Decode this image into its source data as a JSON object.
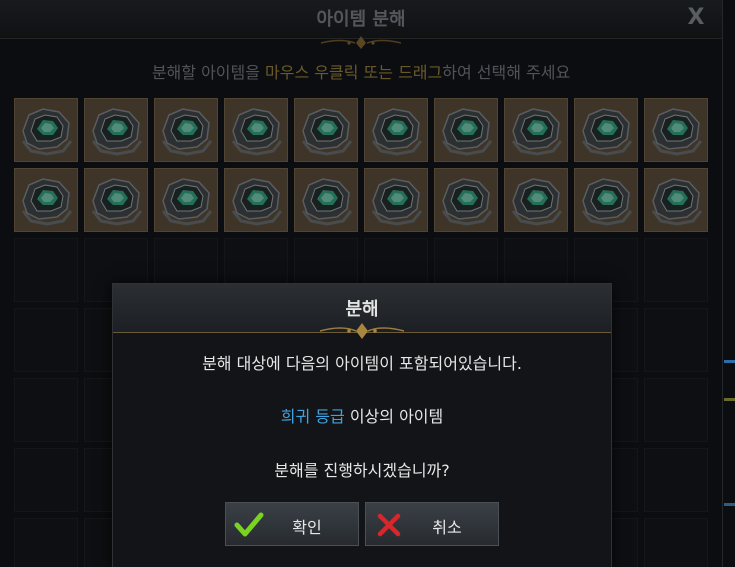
{
  "window": {
    "title": "아이템 분해",
    "close_label": "X"
  },
  "instruction": {
    "part1": "분해할 아이템을 ",
    "highlight": "마우스 우클릭 또는 드래그",
    "part2": "하여 선택해 주세요"
  },
  "grid": {
    "columns": 10,
    "visible_rows": 7,
    "filled_count": 20,
    "item_icon": "armor-shoulder-icon"
  },
  "dialog": {
    "title": "분해",
    "line1": "분해 대상에 다음의 아이템이 포함되어있습니다.",
    "line2_highlight": "희귀 등급",
    "line2_rest": " 이상의 아이템",
    "line3": "분해를 진행하시겠습니까?",
    "confirm_label": "확인",
    "cancel_label": "취소"
  },
  "colors": {
    "highlight_gold": "#b59a49",
    "rare_blue": "#3fa3e0",
    "confirm_check": "#7bd321",
    "cancel_x": "#d8262b"
  }
}
